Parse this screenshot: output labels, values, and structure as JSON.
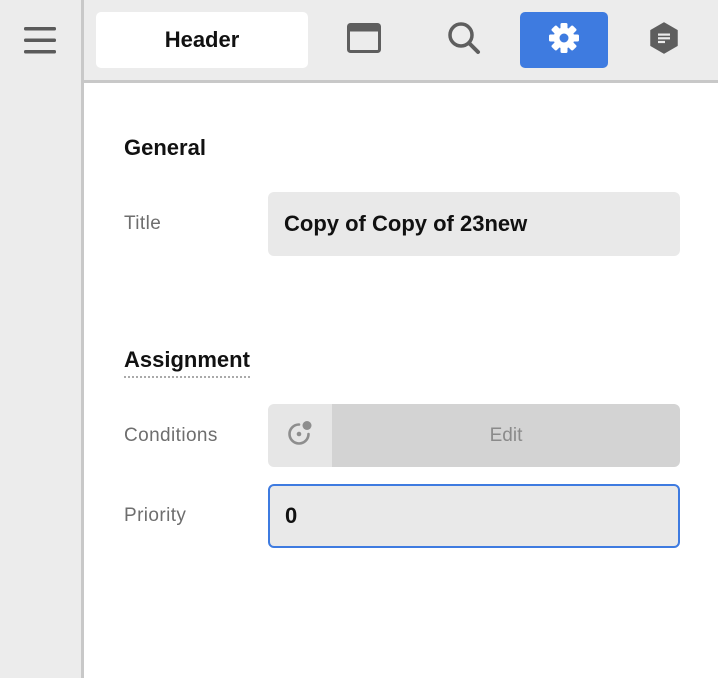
{
  "sidebar": {
    "menu_icon": "hamburger-menu-icon"
  },
  "toolbar": {
    "tabs": [
      {
        "label": "Header",
        "icon": "text-tab",
        "active": false
      },
      {
        "label": "",
        "icon": "layout-window-icon",
        "active": false
      },
      {
        "label": "",
        "icon": "search-icon",
        "active": false
      },
      {
        "label": "",
        "icon": "gear-icon",
        "active": true
      },
      {
        "label": "",
        "icon": "info-hexagon-icon",
        "active": false
      }
    ]
  },
  "general": {
    "section_title": "General",
    "title_label": "Title",
    "title_value": "Copy of Copy of 23new"
  },
  "assignment": {
    "section_title": "Assignment",
    "conditions_label": "Conditions",
    "conditions_icon": "conditions-target-icon",
    "edit_label": "Edit",
    "priority_label": "Priority",
    "priority_value": "0"
  },
  "colors": {
    "accent": "#3e7be0",
    "rail_bg": "#ececec",
    "field_bg": "#e9e9e9",
    "edit_bg": "#d3d3d3"
  }
}
